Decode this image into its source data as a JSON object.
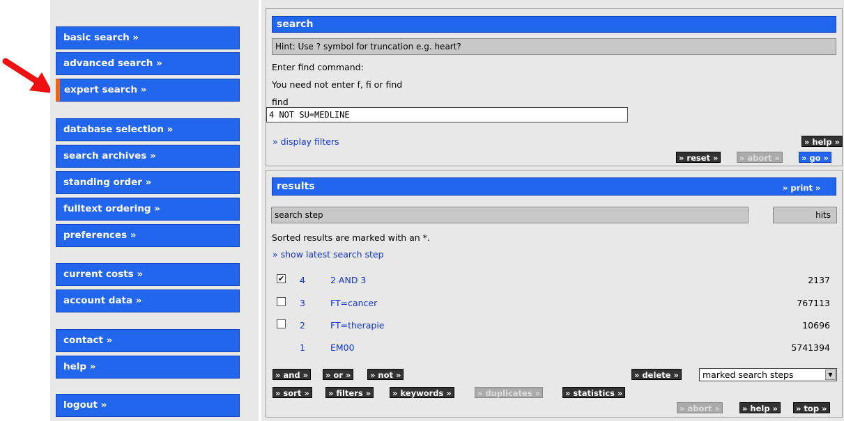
{
  "nav": {
    "basic_search": "basic search »",
    "advanced_search": "advanced search »",
    "expert_search": "expert search »",
    "database_selection": "database selection »",
    "search_archives": "search archives »",
    "standing_order": "standing order »",
    "fulltext_ordering": "fulltext ordering »",
    "preferences": "preferences »",
    "current_costs": "current costs »",
    "account_data": "account data »",
    "contact": "contact »",
    "help": "help »",
    "logout": "logout »"
  },
  "search": {
    "title": "search",
    "hint": "Hint: Use ? symbol for truncation e.g. heart?",
    "enter_command": "Enter find command:",
    "need_not": "You need not enter f, fi or find",
    "find_label": "find",
    "find_value": "4 NOT SU=MEDLINE",
    "display_filters": "» display filters",
    "help_btn": "» help »",
    "reset_btn": "» reset »",
    "abort_btn": "» abort »",
    "go_btn": "» go »"
  },
  "results": {
    "title": "results",
    "print_btn": "» print »",
    "col_step": "search step",
    "col_hits": "hits",
    "sorted_note": "Sorted results are marked with an *.",
    "show_latest": "» show latest search step",
    "rows": [
      {
        "num": "4",
        "query": "2 AND 3",
        "hits": "2137",
        "checked": true
      },
      {
        "num": "3",
        "query": "FT=cancer",
        "hits": "767113",
        "checked": false
      },
      {
        "num": "2",
        "query": "FT=therapie",
        "hits": "10696",
        "checked": false
      },
      {
        "num": "1",
        "query": "EM00",
        "hits": "5741394",
        "checked": null
      }
    ],
    "and_btn": "» and »",
    "or_btn": "» or »",
    "not_btn": "» not »",
    "delete_btn": "» delete »",
    "delete_select": "marked search steps",
    "sort_btn": "» sort »",
    "filters_btn": "» filters »",
    "keywords_btn": "» keywords »",
    "duplicates_btn": "» duplicates »",
    "statistics_btn": "» statistics »",
    "abort_btn": "» abort »",
    "help_btn": "» help »",
    "top_btn": "» top »"
  },
  "colors": {
    "accent": "#2266ee",
    "active_marker": "#ee6611",
    "arrow": "#ee1111"
  },
  "icons": [
    "arrow-pointer-icon",
    "chevron-down-icon",
    "checkbox-checked-icon"
  ]
}
